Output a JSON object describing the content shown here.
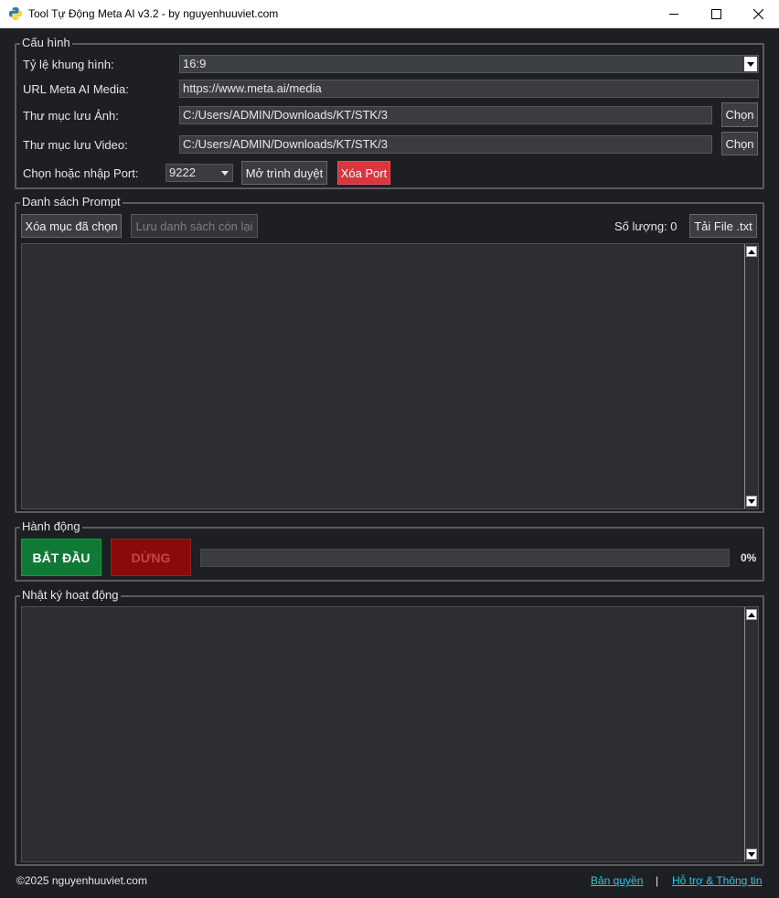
{
  "window": {
    "title": "Tool Tự Động Meta AI v3.2 - by nguyenhuuviet.com"
  },
  "config": {
    "group_title": "Cấu hình",
    "aspect_label": "Tỷ lệ khung hình:",
    "aspect_value": "16:9",
    "url_label": "URL Meta AI Media:",
    "url_value": "https://www.meta.ai/media",
    "image_folder_label": "Thư mục lưu Ảnh:",
    "image_folder_value": "C:/Users/ADMIN/Downloads/KT/STK/3",
    "image_choose_label": "Chọn",
    "video_folder_label": "Thư mục lưu Video:",
    "video_folder_value": "C:/Users/ADMIN/Downloads/KT/STK/3",
    "video_choose_label": "Chọn",
    "port_label": "Chọn hoặc nhập Port:",
    "port_value": "9222",
    "open_browser_label": "Mở trình duyệt",
    "delete_port_label": "Xóa Port"
  },
  "prompts": {
    "group_title": "Danh sách Prompt",
    "delete_selected_label": "Xóa mục đã chọn",
    "save_remaining_label": "Lưu danh sách còn lại",
    "count_text": "Số lượng: 0",
    "load_file_label": "Tải File .txt",
    "items": []
  },
  "actions": {
    "group_title": "Hành động",
    "start_label": "BẮT ĐẦU",
    "stop_label": "DỪNG",
    "progress_percent": 0,
    "progress_text": "0%"
  },
  "log": {
    "group_title": "Nhật ký hoạt động",
    "lines": []
  },
  "footer": {
    "copyright": "©2025 nguyenhuuviet.com",
    "license_link": "Bản quyền",
    "separator": "|",
    "support_link": "Hỗ trợ & Thông tin"
  },
  "colors": {
    "start_button": "#0f7a35",
    "stop_button": "#8a0a0a",
    "delete_port": "#d9373f",
    "link": "#28c8e8"
  }
}
